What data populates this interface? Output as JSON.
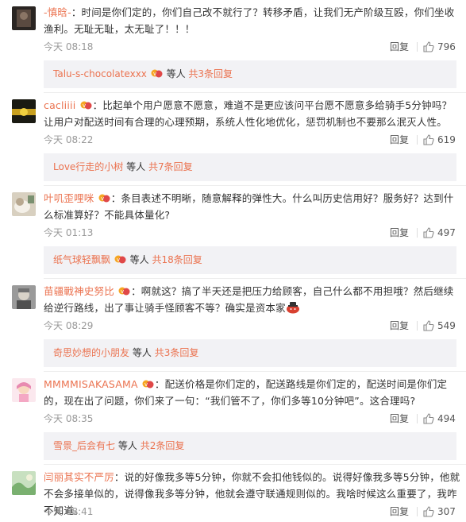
{
  "colors": {
    "accent": "#eb7350",
    "meta": "#999999",
    "sub_bg": "#f2f2f5"
  },
  "comments": [
    {
      "user": "-慎晗-",
      "vip": false,
      "text": "：时间是你们定的，你们自己改不就行了？转移矛盾，让我们无产阶级互殴，你们坐收渔利。无耻无耻，太无耻了！！！",
      "time": "今天 08:18",
      "reply_label": "回复",
      "likes": "796",
      "sub": {
        "user": "Talu-s-chocolatexxx",
        "middle": "等人",
        "count": "共3条回复"
      }
    },
    {
      "user": "cacliiii",
      "vip": true,
      "text": "：比起单个用户愿意不愿意，难道不是更应该问平台愿不愿意多给骑手5分钟吗？让用户对配送时间有合理的心理预期，系统人性化地优化，惩罚机制也不要那么泯灭人性。",
      "time": "今天 08:22",
      "reply_label": "回复",
      "likes": "619",
      "sub": {
        "user": "Love行走的小树",
        "middle": "等人",
        "count": "共7条回复"
      }
    },
    {
      "user": "叶叽歪哩咪",
      "vip": true,
      "text": "：条目表述不明晰，随意解释的弹性大。什么叫历史信用好？服务好？达到什么标准算好？不能具体量化?",
      "time": "今天 01:13",
      "reply_label": "回复",
      "likes": "497",
      "sub": {
        "user": "纸气球轻飘飘",
        "middle": "等人",
        "count": "共18条回复"
      }
    },
    {
      "user": "苗疆戰神史努比",
      "vip": true,
      "text": "：啊就这？搞了半天还是把压力给顾客，自己什么都不用担哦？然后继续给逆行路线，出了事让骑手怪顾客不等？确实是资本家",
      "emoji_end": true,
      "time": "今天 08:29",
      "reply_label": "回复",
      "likes": "549",
      "sub": {
        "user": "奇思妙想的小朋友",
        "middle": "等人",
        "count": "共3条回复"
      }
    },
    {
      "user": "MMMMISAKASAMA",
      "vip": true,
      "text": "：配送价格是你们定的，配送路线是你们定的，配送时间是你们定的，现在出了问题，你们来了一句：“我们管不了，你们多等10分钟吧”。这合理吗?",
      "time": "今天 08:35",
      "reply_label": "回复",
      "likes": "494",
      "sub": {
        "user": "雪景_后会有七",
        "middle": "等人",
        "count": "共2条回复"
      }
    },
    {
      "user": "闫丽其实不严厉",
      "vip": false,
      "text": "：说的好像我多等5分钟，你就不会扣他钱似的。说得好像我多等5分钟，他就不会多接单似的，说得像我多等分钟，他就会遵守联通规则似的。我啥时候这么重要了，我咋不知道。",
      "time": "今天 08:41",
      "reply_label": "回复",
      "likes": "307"
    }
  ]
}
